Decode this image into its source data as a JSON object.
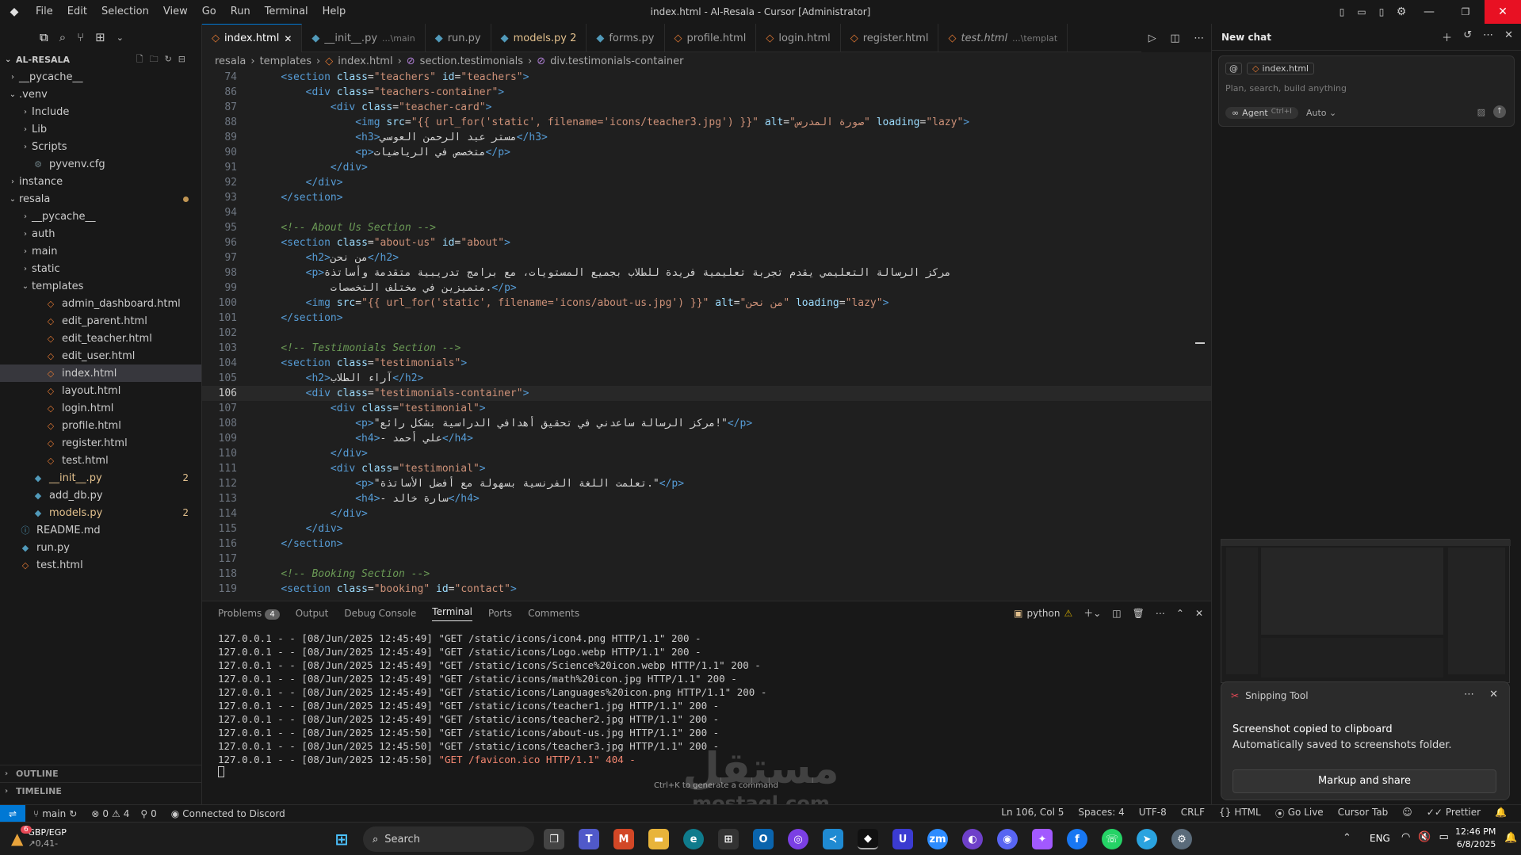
{
  "titlebar": {
    "menus": [
      "File",
      "Edit",
      "Selection",
      "View",
      "Go",
      "Run",
      "Terminal",
      "Help"
    ],
    "title": "index.html - Al-Resala - Cursor [Administrator]"
  },
  "sidebar": {
    "root": "AL-RESALA",
    "items": [
      {
        "label": "__pycache__",
        "depth": 1,
        "kind": "folder",
        "open": false
      },
      {
        "label": ".venv",
        "depth": 1,
        "kind": "folder",
        "open": true
      },
      {
        "label": "Include",
        "depth": 2,
        "kind": "folder",
        "open": false
      },
      {
        "label": "Lib",
        "depth": 2,
        "kind": "folder",
        "open": false
      },
      {
        "label": "Scripts",
        "depth": 2,
        "kind": "folder",
        "open": false
      },
      {
        "label": "pyvenv.cfg",
        "depth": 2,
        "kind": "cfg"
      },
      {
        "label": "instance",
        "depth": 1,
        "kind": "folder",
        "open": false
      },
      {
        "label": "resala",
        "depth": 1,
        "kind": "folder",
        "open": true,
        "modified": true
      },
      {
        "label": "__pycache__",
        "depth": 2,
        "kind": "folder",
        "open": false
      },
      {
        "label": "auth",
        "depth": 2,
        "kind": "folder",
        "open": false
      },
      {
        "label": "main",
        "depth": 2,
        "kind": "folder",
        "open": false
      },
      {
        "label": "static",
        "depth": 2,
        "kind": "folder",
        "open": false
      },
      {
        "label": "templates",
        "depth": 2,
        "kind": "folder",
        "open": true
      },
      {
        "label": "admin_dashboard.html",
        "depth": 3,
        "kind": "html"
      },
      {
        "label": "edit_parent.html",
        "depth": 3,
        "kind": "html"
      },
      {
        "label": "edit_teacher.html",
        "depth": 3,
        "kind": "html"
      },
      {
        "label": "edit_user.html",
        "depth": 3,
        "kind": "html"
      },
      {
        "label": "index.html",
        "depth": 3,
        "kind": "html",
        "selected": true
      },
      {
        "label": "layout.html",
        "depth": 3,
        "kind": "html"
      },
      {
        "label": "login.html",
        "depth": 3,
        "kind": "html"
      },
      {
        "label": "profile.html",
        "depth": 3,
        "kind": "html"
      },
      {
        "label": "register.html",
        "depth": 3,
        "kind": "html"
      },
      {
        "label": "test.html",
        "depth": 3,
        "kind": "html"
      },
      {
        "label": "__init__.py",
        "depth": 2,
        "kind": "py",
        "badge": "2",
        "warn": true
      },
      {
        "label": "add_db.py",
        "depth": 2,
        "kind": "py"
      },
      {
        "label": "models.py",
        "depth": 2,
        "kind": "py",
        "badge": "2",
        "warn": true
      },
      {
        "label": "README.md",
        "depth": 1,
        "kind": "md"
      },
      {
        "label": "run.py",
        "depth": 1,
        "kind": "py"
      },
      {
        "label": "test.html",
        "depth": 1,
        "kind": "html"
      }
    ],
    "outline": "OUTLINE",
    "timeline": "TIMELINE"
  },
  "tabs": [
    {
      "label": "index.html",
      "kind": "html",
      "active": true
    },
    {
      "label": "__init__.py",
      "sub": "...\\main",
      "kind": "py"
    },
    {
      "label": "run.py",
      "kind": "py"
    },
    {
      "label": "models.py 2",
      "kind": "py",
      "warn": true
    },
    {
      "label": "forms.py",
      "kind": "py"
    },
    {
      "label": "profile.html",
      "kind": "html"
    },
    {
      "label": "login.html",
      "kind": "html"
    },
    {
      "label": "register.html",
      "kind": "html"
    },
    {
      "label": "test.html",
      "sub": "...\\templat",
      "kind": "html",
      "italic": true
    }
  ],
  "breadcrumb": [
    "resala",
    "templates",
    "index.html",
    "section.testimonials",
    "div.testimonials-container"
  ],
  "editor": {
    "current_line": "106",
    "lines": [
      {
        "n": "74",
        "h": "    <span class='t'>&lt;section</span> <span class='a'>class</span><span class='x'>=</span><span class='s'>\"teachers\"</span> <span class='a'>id</span><span class='x'>=</span><span class='s'>\"teachers\"</span><span class='t'>&gt;</span>"
      },
      {
        "n": "86",
        "h": "        <span class='t'>&lt;div</span> <span class='a'>class</span><span class='x'>=</span><span class='s'>\"teachers-container\"</span><span class='t'>&gt;</span>"
      },
      {
        "n": "87",
        "h": "            <span class='t'>&lt;div</span> <span class='a'>class</span><span class='x'>=</span><span class='s'>\"teacher-card\"</span><span class='t'>&gt;</span>"
      },
      {
        "n": "88",
        "h": "                <span class='t'>&lt;img</span> <span class='a'>src</span><span class='x'>=</span><span class='s'>\"{{ url_for('static', filename='icons/teacher3.jpg') }}\"</span> <span class='a'>alt</span><span class='x'>=</span><span class='s'>\"صورة المدرس\"</span> <span class='a'>loading</span><span class='x'>=</span><span class='s'>\"lazy\"</span><span class='t'>&gt;</span>"
      },
      {
        "n": "89",
        "h": "                <span class='t'>&lt;h3&gt;</span><span class='x'>مستر عبد الرحمن العوسي</span><span class='t'>&lt;/h3&gt;</span>"
      },
      {
        "n": "90",
        "h": "                <span class='t'>&lt;p&gt;</span><span class='x'>متخصص في الرياضيات</span><span class='t'>&lt;/p&gt;</span>"
      },
      {
        "n": "91",
        "h": "            <span class='t'>&lt;/div&gt;</span>"
      },
      {
        "n": "92",
        "h": "        <span class='t'>&lt;/div&gt;</span>"
      },
      {
        "n": "93",
        "h": "    <span class='t'>&lt;/section&gt;</span>"
      },
      {
        "n": "94",
        "h": ""
      },
      {
        "n": "95",
        "h": "    <span class='c'>&lt;!-- About Us Section --&gt;</span>"
      },
      {
        "n": "96",
        "h": "    <span class='t'>&lt;section</span> <span class='a'>class</span><span class='x'>=</span><span class='s'>\"about-us\"</span> <span class='a'>id</span><span class='x'>=</span><span class='s'>\"about\"</span><span class='t'>&gt;</span>"
      },
      {
        "n": "97",
        "h": "        <span class='t'>&lt;h2&gt;</span><span class='x'>من نحن</span><span class='t'>&lt;/h2&gt;</span>"
      },
      {
        "n": "98",
        "h": "        <span class='t'>&lt;p&gt;</span><span class='x'>مركز الرسالة التعليمي يقدم تجربة تعليمية فريدة للطلاب بجميع المستويات، مع برامج تدريبية متقدمة وأساتذة</span>"
      },
      {
        "n": "99",
        "h": "            <span class='x'>متميزين في مختلف التخصصات.</span><span class='t'>&lt;/p&gt;</span>"
      },
      {
        "n": "100",
        "h": "        <span class='t'>&lt;img</span> <span class='a'>src</span><span class='x'>=</span><span class='s'>\"{{ url_for('static', filename='icons/about-us.jpg') }}\"</span> <span class='a'>alt</span><span class='x'>=</span><span class='s'>\"من نحن\"</span> <span class='a'>loading</span><span class='x'>=</span><span class='s'>\"lazy\"</span><span class='t'>&gt;</span>"
      },
      {
        "n": "101",
        "h": "    <span class='t'>&lt;/section&gt;</span>"
      },
      {
        "n": "102",
        "h": ""
      },
      {
        "n": "103",
        "h": "    <span class='c'>&lt;!-- Testimonials Section --&gt;</span>"
      },
      {
        "n": "104",
        "h": "    <span class='t'>&lt;section</span> <span class='a'>class</span><span class='x'>=</span><span class='s'>\"testimonials\"</span><span class='t'>&gt;</span>"
      },
      {
        "n": "105",
        "h": "        <span class='t'>&lt;h2&gt;</span><span class='x'>آراء الطلاب</span><span class='t'>&lt;/h2&gt;</span>"
      },
      {
        "n": "106",
        "h": "        <span class='t'>&lt;div</span> <span class='a'>class</span><span class='x'>=</span><span class='s'>\"testimonials-container\"</span><span class='t'>&gt;</span>"
      },
      {
        "n": "107",
        "h": "            <span class='t'>&lt;div</span> <span class='a'>class</span><span class='x'>=</span><span class='s'>\"testimonial\"</span><span class='t'>&gt;</span>"
      },
      {
        "n": "108",
        "h": "                <span class='t'>&lt;p&gt;</span><span class='x'>\"مركز الرسالة ساعدني في تحقيق أهدافي الدراسية بشكل رائع!\"</span><span class='t'>&lt;/p&gt;</span>"
      },
      {
        "n": "109",
        "h": "                <span class='t'>&lt;h4&gt;</span><span class='x'>- علي أحمد</span><span class='t'>&lt;/h4&gt;</span>"
      },
      {
        "n": "110",
        "h": "            <span class='t'>&lt;/div&gt;</span>"
      },
      {
        "n": "111",
        "h": "            <span class='t'>&lt;div</span> <span class='a'>class</span><span class='x'>=</span><span class='s'>\"testimonial\"</span><span class='t'>&gt;</span>"
      },
      {
        "n": "112",
        "h": "                <span class='t'>&lt;p&gt;</span><span class='x'>\"تعلمت اللغة الفرنسية بسهولة مع أفضل الأساتذة.\"</span><span class='t'>&lt;/p&gt;</span>"
      },
      {
        "n": "113",
        "h": "                <span class='t'>&lt;h4&gt;</span><span class='x'>- سارة خالد</span><span class='t'>&lt;/h4&gt;</span>"
      },
      {
        "n": "114",
        "h": "            <span class='t'>&lt;/div&gt;</span>"
      },
      {
        "n": "115",
        "h": "        <span class='t'>&lt;/div&gt;</span>"
      },
      {
        "n": "116",
        "h": "    <span class='t'>&lt;/section&gt;</span>"
      },
      {
        "n": "117",
        "h": ""
      },
      {
        "n": "118",
        "h": "    <span class='c'>&lt;!-- Booking Section --&gt;</span>"
      },
      {
        "n": "119",
        "h": "    <span class='t'>&lt;section</span> <span class='a'>class</span><span class='x'>=</span><span class='s'>\"booking\"</span> <span class='a'>id</span><span class='x'>=</span><span class='s'>\"contact\"</span><span class='t'>&gt;</span>"
      }
    ]
  },
  "panel": {
    "tabs": [
      "Problems",
      "Output",
      "Debug Console",
      "Terminal",
      "Ports",
      "Comments"
    ],
    "problems_count": "4",
    "active_tab": "Terminal",
    "shell": "python",
    "hint": "Ctrl+K to generate a command",
    "lines": [
      "127.0.0.1 - - [08/Jun/2025 12:45:49] \"GET /static/icons/icon4.png HTTP/1.1\" 200 -",
      "127.0.0.1 - - [08/Jun/2025 12:45:49] \"GET /static/icons/Logo.webp HTTP/1.1\" 200 -",
      "127.0.0.1 - - [08/Jun/2025 12:45:49] \"GET /static/icons/Science%20icon.webp HTTP/1.1\" 200 -",
      "127.0.0.1 - - [08/Jun/2025 12:45:49] \"GET /static/icons/math%20icon.jpg HTTP/1.1\" 200 -",
      "127.0.0.1 - - [08/Jun/2025 12:45:49] \"GET /static/icons/Languages%20icon.png HTTP/1.1\" 200 -",
      "127.0.0.1 - - [08/Jun/2025 12:45:49] \"GET /static/icons/teacher1.jpg HTTP/1.1\" 200 -",
      "127.0.0.1 - - [08/Jun/2025 12:45:49] \"GET /static/icons/teacher2.jpg HTTP/1.1\" 200 -",
      "127.0.0.1 - - [08/Jun/2025 12:45:50] \"GET /static/icons/about-us.jpg HTTP/1.1\" 200 -",
      "127.0.0.1 - - [08/Jun/2025 12:45:50] \"GET /static/icons/teacher3.jpg HTTP/1.1\" 200 -"
    ],
    "last_prefix": "127.0.0.1 - - [08/Jun/2025 12:45:50] ",
    "last_error": "\"GET /favicon.ico HTTP/1.1\" 404 -"
  },
  "chat": {
    "title": "New chat",
    "context_chip": "index.html",
    "placeholder": "Plan, search, build anything",
    "mode": "Agent",
    "mode_shortcut": "Ctrl+I",
    "model": "Auto"
  },
  "toast": {
    "app": "Snipping Tool",
    "title": "Screenshot copied to clipboard",
    "body": "Automatically saved to screenshots folder.",
    "action": "Markup and share"
  },
  "statusbar": {
    "branch": "main",
    "errors": "0",
    "warnings": "4",
    "ports": "0",
    "discord": "Connected to Discord",
    "position": "Ln 106, Col 5",
    "spaces": "Spaces: 4",
    "encoding": "UTF-8",
    "eol": "CRLF",
    "language": "HTML",
    "golive": "Go Live",
    "cursor_tab": "Cursor Tab",
    "prettier": "Prettier"
  },
  "taskbar": {
    "weather_title": "GBP/EGP",
    "weather_value": "↗0,41-",
    "weather_badge": "6",
    "search": "Search",
    "lang": "ENG",
    "time": "12:46 PM",
    "date": "6/8/2025"
  },
  "watermark": {
    "brand": "مستقل",
    "url": "mostaql.com"
  }
}
